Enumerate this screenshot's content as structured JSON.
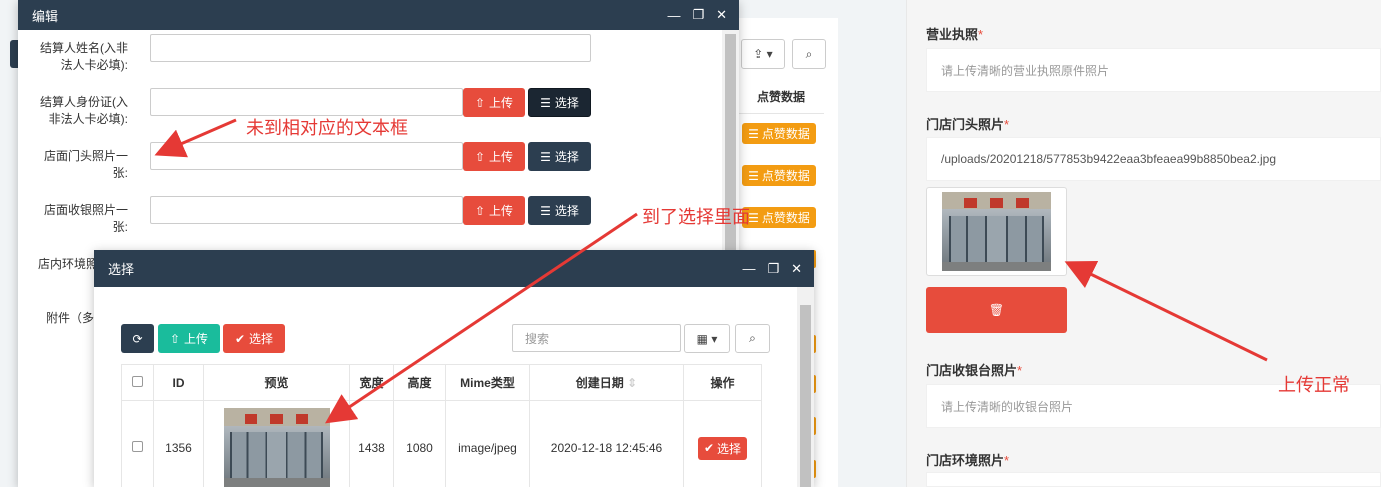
{
  "background": {
    "column_header": "点赞数据",
    "like_button_label": "点赞数据",
    "like_icon": "list-icon"
  },
  "right_form": {
    "fields": [
      {
        "label": "营业执照",
        "required_mark": "*",
        "placeholder": "请上传清晰的营业执照原件照片"
      },
      {
        "label": "门店门头照片",
        "required_mark": "*",
        "value": "/uploads/20201218/577853b9422eaa3bfeaea99b8850bea2.jpg"
      },
      {
        "label": "门店收银台照片",
        "required_mark": "*",
        "placeholder": "请上传清晰的收银台照片"
      },
      {
        "label": "门店环境照片",
        "required_mark": "*"
      }
    ],
    "delete_icon": "trash-icon"
  },
  "edit_modal": {
    "title": "编辑",
    "rows": [
      {
        "label": "结算人姓名(入非法人卡必填):"
      },
      {
        "label": "结算人身份证(入非法人卡必填):",
        "upload_label": "上传",
        "select_label": "选择"
      },
      {
        "label": "店面门头照片一张:",
        "upload_label": "上传",
        "select_label": "选择"
      },
      {
        "label": "店面收银照片一张:",
        "upload_label": "上传",
        "select_label": "选择"
      },
      {
        "label": "店内环境照"
      },
      {
        "label": "附件（多"
      }
    ]
  },
  "select_modal": {
    "title": "选择",
    "refresh_icon": "refresh-icon",
    "upload_label": "上传",
    "select_label": "选择",
    "search_placeholder": "搜索",
    "columns": [
      "ID",
      "预览",
      "宽度",
      "高度",
      "Mime类型",
      "创建日期",
      "操作"
    ],
    "rows": [
      {
        "id": "1356",
        "width": "1438",
        "height": "1080",
        "mime": "image/jpeg",
        "created": "2020-12-18 12:45:46",
        "action": "选择"
      }
    ]
  },
  "annotations": {
    "text1": "未到相对应的文本框",
    "text2": "到了选择里面",
    "text3": "上传正常",
    "color": "#e53935"
  }
}
